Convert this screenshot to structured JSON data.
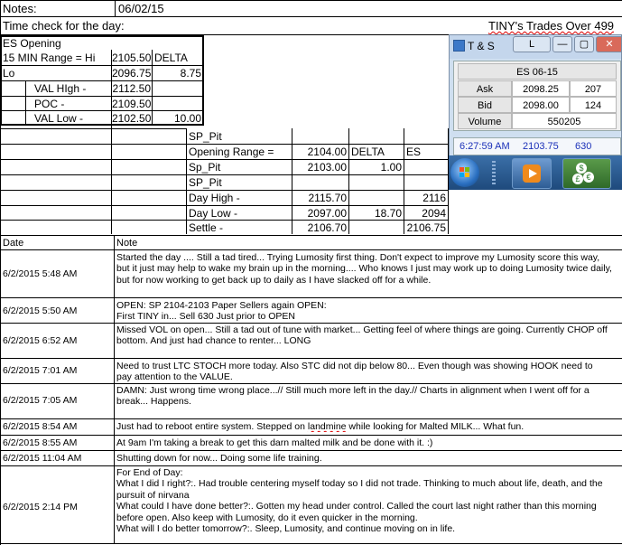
{
  "sheet": {
    "notes_label": "Notes:",
    "notes_date": "06/02/15",
    "time_check": "Time check for the day:",
    "header_right": "TINY's Trades Over 499",
    "es_block": {
      "title": "ES Opening",
      "range_label": "15 MIN Range = Hi",
      "hi": "2105.50",
      "delta_label": "DELTA",
      "lo_label": "Lo",
      "lo": "2096.75",
      "delta": "8.75",
      "vah_label": "VAL HIgh  -",
      "vah": "2112.50",
      "poc_label": "POC  -",
      "poc": "2109.50",
      "val_label": "VAL Low  -",
      "val": "2102.50",
      "val_delta": "10.00"
    },
    "sp_block": {
      "title1": "SP_Pit",
      "or_label": "Opening Range =",
      "or_hi": "2104.00",
      "delta_label": "DELTA",
      "es_label": "ES",
      "sp_label": "Sp_Pit",
      "sp_lo": "2103.00",
      "sp_delta": "1.00",
      "title2": "SP_Pit",
      "dh_label": "Day High -",
      "dh": "2115.70",
      "dh_es": "2116",
      "dl_label": "Day Low -",
      "dl": "2097.00",
      "dl_delta": "18.70",
      "dl_es": "2094",
      "settle_label": "Settle -",
      "settle": "2106.70",
      "settle_es": "2106.75"
    },
    "log_headers": {
      "date": "Date",
      "note": "Note"
    },
    "log": [
      {
        "date": "6/2/2015 5:48 AM",
        "note": "Started the day .... Still a tad tired... Trying Lumosity first thing.  Don't expect to improve my Lumosity score this way,\nbut it just may help to wake my brain up in the morning.... Who knows I just may work up to doing Lumosity twice daily,\nbut for now working to get back up to daily as I have slacked off for a while."
      },
      {
        "date": "6/2/2015 5:50 AM",
        "note": "OPEN: SP 2104-2103 Paper Sellers again OPEN:\nFirst TINY in... Sell 630 Just prior to OPEN"
      },
      {
        "date": "6/2/2015 6:52 AM",
        "note": "Missed VOL on open... Still a tad out of tune with market... Getting feel of where things are going.  Currently CHOP off\nbottom.  And just had chance to renter... LONG"
      },
      {
        "date": "6/2/2015 7:01 AM",
        "note": "Need to trust LTC STOCH more today.  Also STC did not dip below 80... Even though was showing HOOK need to\npay attention to the VALUE."
      },
      {
        "date": "6/2/2015 7:05 AM",
        "note": "DAMN: Just wrong time wrong place...// Still much more left in the day.// Charts in alignment when I went off for a\nbreak... Happens."
      },
      {
        "date": "6/2/2015 8:54 AM",
        "note": "Just had to reboot entire system. Stepped on landmine while looking for Malted MILK... What fun."
      },
      {
        "date": "6/2/2015 8:55 AM",
        "note": "At 9am I'm taking a break to get this darn malted milk and be done with it. :)"
      },
      {
        "date": "6/2/2015 11:04 AM",
        "note": "Shutting down for now... Doing some life training."
      },
      {
        "date": "6/2/2015 2:14 PM",
        "note": "For End of Day:\nWhat I did I right?:.  Had trouble centering myself today so I did not trade.  Thinking to much about life, death, and the\npursuit of nirvana\nWhat could I have done better?:.  Gotten my head under control.  Called the court last night rather than this morning\nbefore open.  Also keep with Lumosity, do it even quicker in the morning.\nWhat will I do better tomorrow?:.  Sleep, Lumosity, and continue moving on in life."
      }
    ]
  },
  "ts_window": {
    "title": "T & S",
    "btn_l": "L",
    "btn_min": "—",
    "btn_max": "▢",
    "btn_close": "✕",
    "symbol": "ES 06-15",
    "ask_label": "Ask",
    "ask": "2098.25",
    "ask_size": "207",
    "bid_label": "Bid",
    "bid": "2098.00",
    "bid_size": "124",
    "vol_label": "Volume",
    "volume": "550205",
    "tick_time": "6:27:59 AM",
    "tick_price": "2103.75",
    "tick_size": "630"
  },
  "taskbar": {
    "start_icon": "windows-orb-icon",
    "media_icon": "media-player-icon",
    "money_icon": "currency-icon"
  },
  "colors": {
    "grid": "#000000",
    "tick_text": "#1a30b8",
    "ts_bg": "#cfdff0"
  }
}
